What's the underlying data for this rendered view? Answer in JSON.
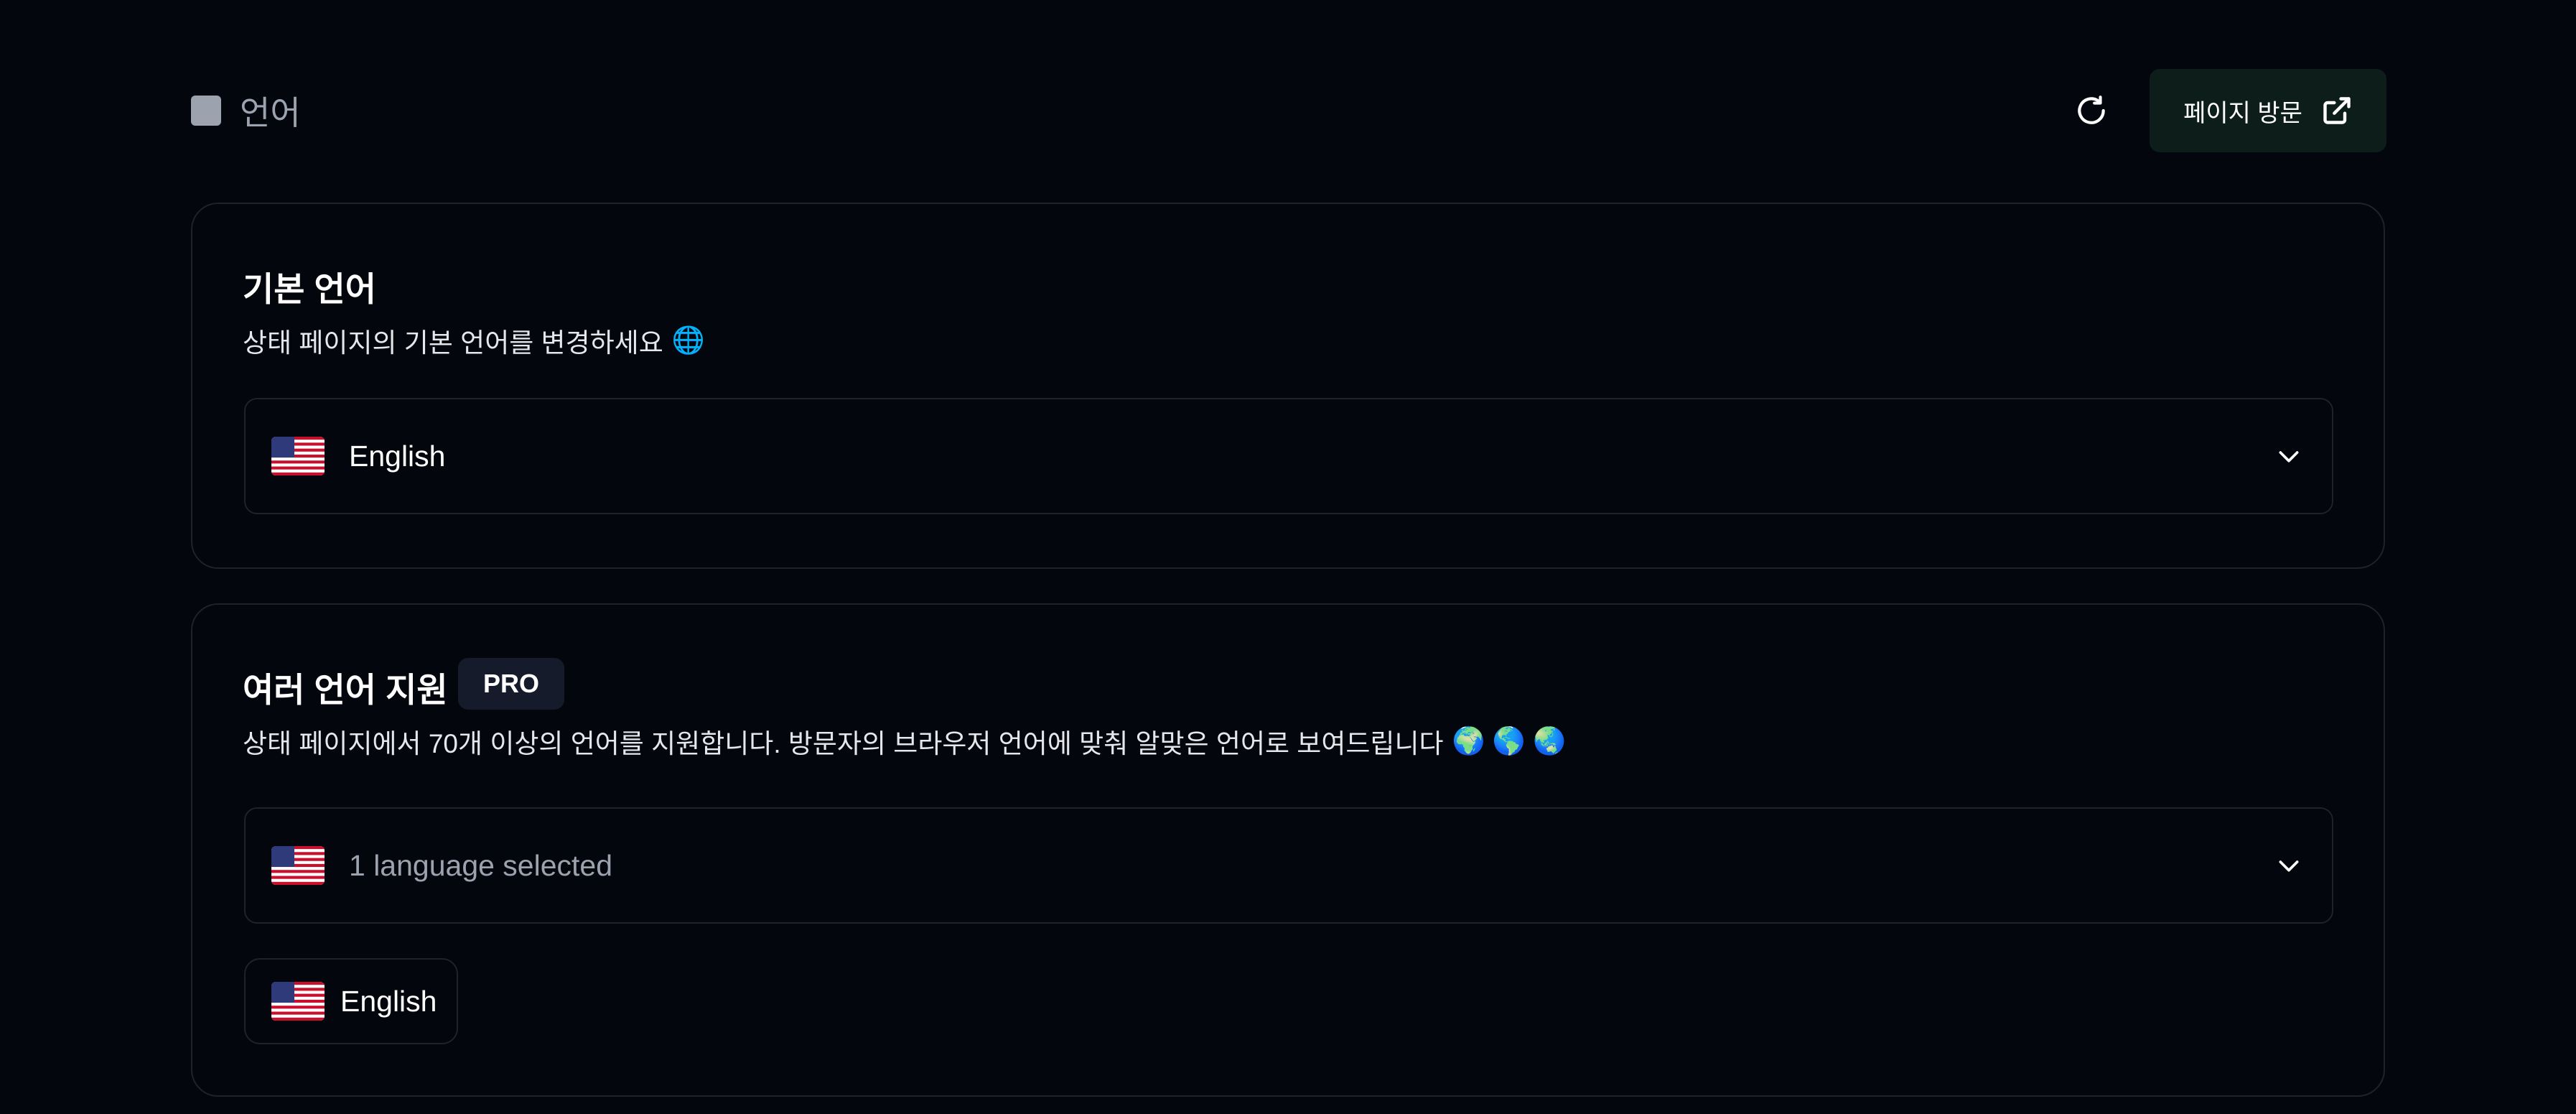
{
  "header": {
    "title": "언어",
    "visit_label": "페이지 방문",
    "icons": {
      "page": "square-icon",
      "refresh": "refresh-icon",
      "external": "external-link-icon"
    }
  },
  "default_language": {
    "title": "기본 언어",
    "description": "상태 페이지의 기본 언어를 변경하세요",
    "description_emoji": "🌐",
    "selected": "English",
    "flag": "us-flag-icon"
  },
  "multi_language": {
    "title": "여러 언어 지원",
    "badge": "PRO",
    "description": "상태 페이지에서 70개 이상의 언어를 지원합니다. 방문자의 브라우저 언어에 맞춰 알맞은 언어로 보여드립니다",
    "description_emoji": "🌍 🌎 🌏",
    "select_placeholder": "1 language selected",
    "chips": [
      {
        "label": "English",
        "flag": "us-flag-icon"
      }
    ]
  },
  "colors": {
    "background": "#04060d",
    "border": "#1e222d",
    "visit_button": "#0d1d1a",
    "badge": "#151b2a",
    "muted_text": "#9ca3af"
  }
}
